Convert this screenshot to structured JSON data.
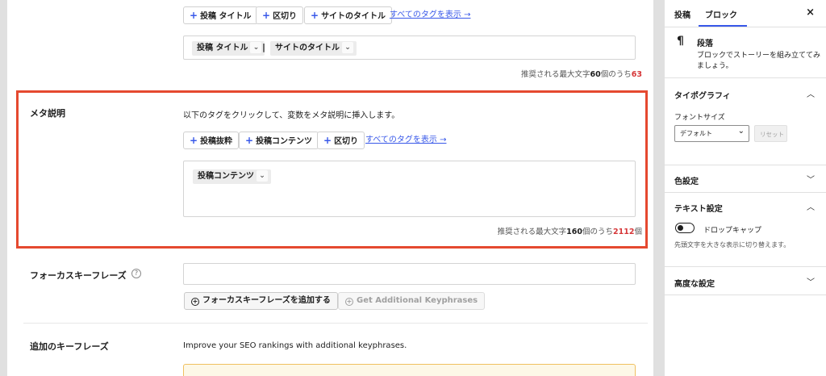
{
  "top": {
    "tags": [
      {
        "label": "投稿 タイトル"
      },
      {
        "label": "区切り"
      },
      {
        "label": "サイトのタイトル"
      }
    ],
    "show_all": "すべてのタグを表示 →",
    "chips": [
      {
        "label": "投稿 タイトル"
      },
      {
        "label": "サイトのタイトル"
      }
    ],
    "separator": "|",
    "counter": {
      "prefix": "推奨される最大文字",
      "max": "60",
      "middle": "個のうち",
      "current": "63"
    }
  },
  "meta": {
    "title": "メタ説明",
    "description": "以下のタグをクリックして、変数をメタ説明に挿入します。",
    "tags": [
      {
        "label": "投稿抜粋"
      },
      {
        "label": "投稿コンテンツ"
      },
      {
        "label": "区切り"
      }
    ],
    "show_all": "すべてのタグを表示 →",
    "chip": "投稿コンテンツ",
    "counter": {
      "prefix": "推奨される最大文字",
      "max": "160",
      "middle": "個のうち",
      "current": "2112",
      "suffix": "個"
    }
  },
  "focus": {
    "title": "フォーカスキーフレーズ",
    "help": "?",
    "add_button": "フォーカスキーフレーズを追加する",
    "get_button": "Get Additional Keyphrases"
  },
  "additional": {
    "title": "追加のキーフレーズ",
    "description": "Improve your SEO rankings with additional keyphrases."
  },
  "sidebar": {
    "tab_post": "投稿",
    "tab_block": "ブロック",
    "close": "×",
    "block": {
      "icon": "¶",
      "name": "段落",
      "description_line1": "ブロックでストーリーを組み立ててみ",
      "description_line2": "ましょう。"
    },
    "typography": {
      "title": "タイポグラフィ",
      "font_size_label": "フォントサイズ",
      "font_size_value": "デフォルト",
      "reset": "リセット"
    },
    "color": {
      "title": "色設定"
    },
    "text": {
      "title": "テキスト設定",
      "dropcap_label": "ドロップキャップ",
      "dropcap_help": "先頭文字を大きな表示に切り替えます。"
    },
    "advanced": {
      "title": "高度な設定"
    }
  },
  "colors": {
    "accent": "#3858e9",
    "highlight": "#e5492f",
    "over_limit": "#d63638"
  }
}
